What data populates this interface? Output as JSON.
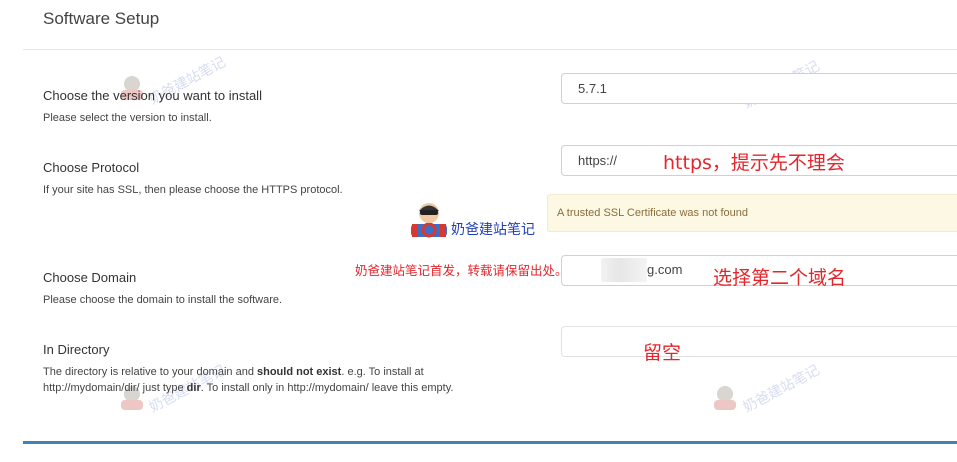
{
  "section": {
    "title": "Software Setup"
  },
  "rows": {
    "version": {
      "label": "Choose the version you want to install",
      "help": "Please select the version to install.",
      "value": "5.7.1"
    },
    "protocol": {
      "label": "Choose Protocol",
      "help": "If your site has SSL, then please choose the HTTPS protocol.",
      "value": "https://",
      "alert": "A trusted SSL Certificate was not found"
    },
    "domain": {
      "label": "Choose Domain",
      "help": "Please choose the domain to install the software.",
      "value_suffix": "g.com"
    },
    "directory": {
      "label": "In Directory",
      "help_1": "The directory is relative to your domain and ",
      "help_bold_1": "should not exist",
      "help_2": ". e.g. To install at",
      "help_3": "http://mydomain/dir/ just type ",
      "help_bold_2": "dir",
      "help_4": ". To install only in http://mydomain/ leave this empty.",
      "value": ""
    }
  },
  "annotations": {
    "protocol_note": "https，提示先不理会",
    "domain_note": "选择第二个域名",
    "directory_note": "留空",
    "copyright_note": "奶爸建站笔记首发，转载请保留出处。"
  },
  "branding": {
    "logo_text": "奶爸建站笔记",
    "watermark_text": "奶爸建站笔记"
  },
  "colors": {
    "annotation": "#e4262c",
    "alert_bg": "#fcf8e3",
    "alert_text": "#8a6d3b",
    "accent_rule": "#3f82b6",
    "logo_text": "#1f3fb8"
  }
}
